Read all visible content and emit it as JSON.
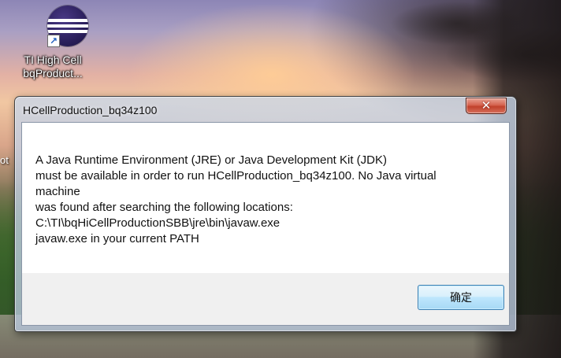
{
  "desktop": {
    "icon": {
      "name": "eclipse-icon",
      "label_line1": "TI High Cell",
      "label_line2": "bqProduct..."
    },
    "edge_text": "ot"
  },
  "dialog": {
    "title": "HCellProduction_bq34z100",
    "close_glyph": "✕",
    "message_lines": [
      "A Java Runtime Environment (JRE) or Java Development Kit (JDK)",
      "must be available in order to run HCellProduction_bq34z100. No Java virtual",
      "machine",
      "was found after searching the following locations:",
      "C:\\TI\\bqHiCellProductionSBB\\jre\\bin\\javaw.exe",
      "javaw.exe in your current PATH"
    ],
    "ok_label": "确定"
  },
  "colors": {
    "close_button": "#c0412b",
    "ok_button_border": "#3c7fb1",
    "footer_bg": "#f0f0f0"
  }
}
